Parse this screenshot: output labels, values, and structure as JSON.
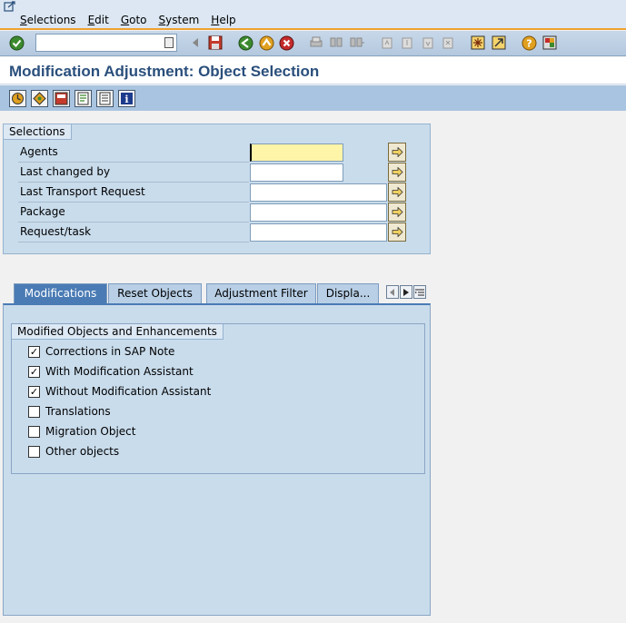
{
  "menu": {
    "items": [
      "Selections",
      "Edit",
      "Goto",
      "System",
      "Help"
    ]
  },
  "toolbar": {
    "command_value": "",
    "icons": [
      "enter-icon",
      "save-icon",
      "back-icon",
      "exit-icon",
      "cancel-icon",
      "print-icon",
      "find-icon",
      "find-next-icon",
      "first-page-icon",
      "prev-page-icon",
      "next-page-icon",
      "last-page-icon",
      "new-session-icon",
      "shortcut-icon",
      "help-icon",
      "layout-icon"
    ]
  },
  "title": "Modification Adjustment: Object Selection",
  "app_toolbar": {
    "icons": [
      "execute-icon",
      "variant-icon",
      "save-variant-icon",
      "edit-icon",
      "list-icon",
      "info-icon"
    ]
  },
  "selections": {
    "title": "Selections",
    "fields": [
      {
        "label": "Agents",
        "value": ""
      },
      {
        "label": "Last changed by",
        "value": ""
      },
      {
        "label": "Last Transport Request",
        "value": ""
      },
      {
        "label": "Package",
        "value": ""
      },
      {
        "label": "Request/task",
        "value": ""
      }
    ]
  },
  "tabs": [
    {
      "label": "Modifications",
      "active": true
    },
    {
      "label": "Reset Objects",
      "active": false
    },
    {
      "label": "Adjustment Filter",
      "active": false
    },
    {
      "label": "Displa...",
      "active": false
    }
  ],
  "modified_objects": {
    "title": "Modified Objects and Enhancements",
    "options": [
      {
        "label": "Corrections in SAP Note",
        "checked": true
      },
      {
        "label": "With Modification Assistant",
        "checked": true
      },
      {
        "label": "Without Modification Assistant",
        "checked": true
      },
      {
        "label": "Translations",
        "checked": false
      },
      {
        "label": "Migration Object",
        "checked": false
      },
      {
        "label": "Other objects",
        "checked": false
      }
    ]
  },
  "colors": {
    "accent": "#f0a030",
    "title_text": "#2a4f7c",
    "active_tab": "#4a7bb4",
    "required_field": "#fff5a8"
  }
}
